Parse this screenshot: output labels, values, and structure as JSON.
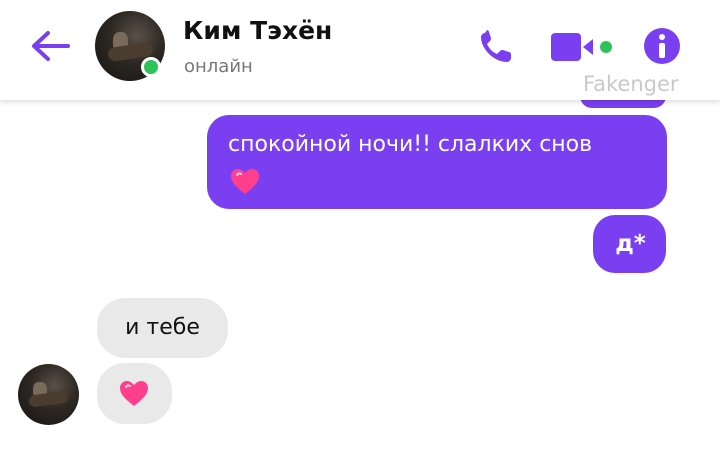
{
  "header": {
    "contact_name": "Ким Тэхён",
    "status": "онлайн",
    "watermark": "Fakenger"
  },
  "messages": [
    {
      "direction": "outgoing",
      "text": "спокойной ночи!! слалких снов",
      "emoji": "heart-icon"
    },
    {
      "direction": "outgoing",
      "text": "д*"
    },
    {
      "direction": "incoming",
      "text": "и тебе"
    },
    {
      "direction": "incoming",
      "emoji": "heart-icon"
    }
  ],
  "colors": {
    "accent": "#7b3ff2",
    "outgoing_bubble": "#7b3ff2",
    "incoming_bubble": "#e9e9e9",
    "online": "#2ec25a",
    "heart": "#ff3f8e"
  },
  "icons": [
    "back-arrow-icon",
    "phone-icon",
    "video-camera-icon",
    "info-icon",
    "heart-icon"
  ]
}
